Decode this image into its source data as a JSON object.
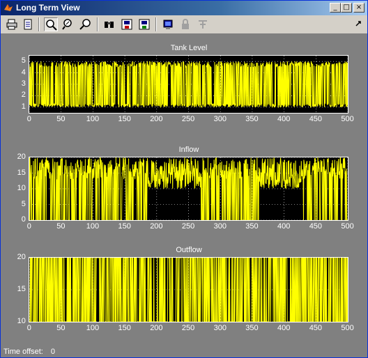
{
  "window": {
    "title": "Long Term View",
    "minimize": "_",
    "maximize": "□",
    "close": "×"
  },
  "toolbar": {
    "icons": [
      "print-icon",
      "print-preview-icon",
      "zoom-icon",
      "zoom-in-icon",
      "zoom-out-icon",
      "find-icon",
      "save-icon",
      "export-icon",
      "scope-params-icon",
      "lock-icon",
      "signal-select-icon",
      "dock-icon"
    ]
  },
  "status": {
    "label": "Time offset:",
    "value": "0"
  },
  "chart_data": [
    {
      "type": "line",
      "title": "Tank Level",
      "xlim": [
        0,
        500
      ],
      "ylim": [
        0.5,
        5.5
      ],
      "xticks": [
        "0",
        "50",
        "100",
        "150",
        "200",
        "250",
        "300",
        "350",
        "400",
        "450",
        "500"
      ],
      "yticks": [
        "1",
        "2",
        "3",
        "4",
        "5"
      ],
      "color": "#ffff00",
      "grid": true
    },
    {
      "type": "line",
      "title": "Inflow",
      "xlim": [
        0,
        500
      ],
      "ylim": [
        0,
        20
      ],
      "xticks": [
        "0",
        "50",
        "100",
        "150",
        "200",
        "250",
        "300",
        "350",
        "400",
        "450",
        "500"
      ],
      "yticks": [
        "0",
        "5",
        "10",
        "15",
        "20"
      ],
      "color": "#ffff00",
      "grid": true
    },
    {
      "type": "line",
      "title": "Outflow",
      "xlim": [
        0,
        500
      ],
      "ylim": [
        10,
        20
      ],
      "xticks": [
        "0",
        "50",
        "100",
        "150",
        "200",
        "250",
        "300",
        "350",
        "400",
        "450",
        "500"
      ],
      "yticks": [
        "10",
        "15",
        "20"
      ],
      "color": "#ffff00",
      "grid": true
    }
  ]
}
